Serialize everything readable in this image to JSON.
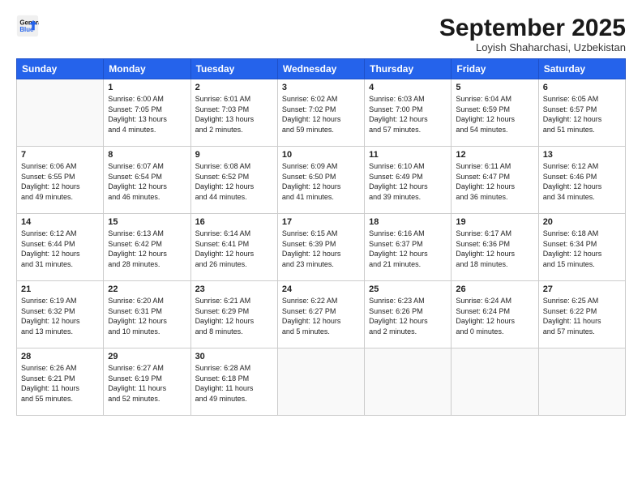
{
  "logo": {
    "line1": "General",
    "line2": "Blue"
  },
  "title": "September 2025",
  "subtitle": "Loyish Shaharchasi, Uzbekistan",
  "header_days": [
    "Sunday",
    "Monday",
    "Tuesday",
    "Wednesday",
    "Thursday",
    "Friday",
    "Saturday"
  ],
  "weeks": [
    [
      {
        "day": null,
        "info": null
      },
      {
        "day": "1",
        "info": "Sunrise: 6:00 AM\nSunset: 7:05 PM\nDaylight: 13 hours\nand 4 minutes."
      },
      {
        "day": "2",
        "info": "Sunrise: 6:01 AM\nSunset: 7:03 PM\nDaylight: 13 hours\nand 2 minutes."
      },
      {
        "day": "3",
        "info": "Sunrise: 6:02 AM\nSunset: 7:02 PM\nDaylight: 12 hours\nand 59 minutes."
      },
      {
        "day": "4",
        "info": "Sunrise: 6:03 AM\nSunset: 7:00 PM\nDaylight: 12 hours\nand 57 minutes."
      },
      {
        "day": "5",
        "info": "Sunrise: 6:04 AM\nSunset: 6:59 PM\nDaylight: 12 hours\nand 54 minutes."
      },
      {
        "day": "6",
        "info": "Sunrise: 6:05 AM\nSunset: 6:57 PM\nDaylight: 12 hours\nand 51 minutes."
      }
    ],
    [
      {
        "day": "7",
        "info": "Sunrise: 6:06 AM\nSunset: 6:55 PM\nDaylight: 12 hours\nand 49 minutes."
      },
      {
        "day": "8",
        "info": "Sunrise: 6:07 AM\nSunset: 6:54 PM\nDaylight: 12 hours\nand 46 minutes."
      },
      {
        "day": "9",
        "info": "Sunrise: 6:08 AM\nSunset: 6:52 PM\nDaylight: 12 hours\nand 44 minutes."
      },
      {
        "day": "10",
        "info": "Sunrise: 6:09 AM\nSunset: 6:50 PM\nDaylight: 12 hours\nand 41 minutes."
      },
      {
        "day": "11",
        "info": "Sunrise: 6:10 AM\nSunset: 6:49 PM\nDaylight: 12 hours\nand 39 minutes."
      },
      {
        "day": "12",
        "info": "Sunrise: 6:11 AM\nSunset: 6:47 PM\nDaylight: 12 hours\nand 36 minutes."
      },
      {
        "day": "13",
        "info": "Sunrise: 6:12 AM\nSunset: 6:46 PM\nDaylight: 12 hours\nand 34 minutes."
      }
    ],
    [
      {
        "day": "14",
        "info": "Sunrise: 6:12 AM\nSunset: 6:44 PM\nDaylight: 12 hours\nand 31 minutes."
      },
      {
        "day": "15",
        "info": "Sunrise: 6:13 AM\nSunset: 6:42 PM\nDaylight: 12 hours\nand 28 minutes."
      },
      {
        "day": "16",
        "info": "Sunrise: 6:14 AM\nSunset: 6:41 PM\nDaylight: 12 hours\nand 26 minutes."
      },
      {
        "day": "17",
        "info": "Sunrise: 6:15 AM\nSunset: 6:39 PM\nDaylight: 12 hours\nand 23 minutes."
      },
      {
        "day": "18",
        "info": "Sunrise: 6:16 AM\nSunset: 6:37 PM\nDaylight: 12 hours\nand 21 minutes."
      },
      {
        "day": "19",
        "info": "Sunrise: 6:17 AM\nSunset: 6:36 PM\nDaylight: 12 hours\nand 18 minutes."
      },
      {
        "day": "20",
        "info": "Sunrise: 6:18 AM\nSunset: 6:34 PM\nDaylight: 12 hours\nand 15 minutes."
      }
    ],
    [
      {
        "day": "21",
        "info": "Sunrise: 6:19 AM\nSunset: 6:32 PM\nDaylight: 12 hours\nand 13 minutes."
      },
      {
        "day": "22",
        "info": "Sunrise: 6:20 AM\nSunset: 6:31 PM\nDaylight: 12 hours\nand 10 minutes."
      },
      {
        "day": "23",
        "info": "Sunrise: 6:21 AM\nSunset: 6:29 PM\nDaylight: 12 hours\nand 8 minutes."
      },
      {
        "day": "24",
        "info": "Sunrise: 6:22 AM\nSunset: 6:27 PM\nDaylight: 12 hours\nand 5 minutes."
      },
      {
        "day": "25",
        "info": "Sunrise: 6:23 AM\nSunset: 6:26 PM\nDaylight: 12 hours\nand 2 minutes."
      },
      {
        "day": "26",
        "info": "Sunrise: 6:24 AM\nSunset: 6:24 PM\nDaylight: 12 hours\nand 0 minutes."
      },
      {
        "day": "27",
        "info": "Sunrise: 6:25 AM\nSunset: 6:22 PM\nDaylight: 11 hours\nand 57 minutes."
      }
    ],
    [
      {
        "day": "28",
        "info": "Sunrise: 6:26 AM\nSunset: 6:21 PM\nDaylight: 11 hours\nand 55 minutes."
      },
      {
        "day": "29",
        "info": "Sunrise: 6:27 AM\nSunset: 6:19 PM\nDaylight: 11 hours\nand 52 minutes."
      },
      {
        "day": "30",
        "info": "Sunrise: 6:28 AM\nSunset: 6:18 PM\nDaylight: 11 hours\nand 49 minutes."
      },
      {
        "day": null,
        "info": null
      },
      {
        "day": null,
        "info": null
      },
      {
        "day": null,
        "info": null
      },
      {
        "day": null,
        "info": null
      }
    ]
  ]
}
